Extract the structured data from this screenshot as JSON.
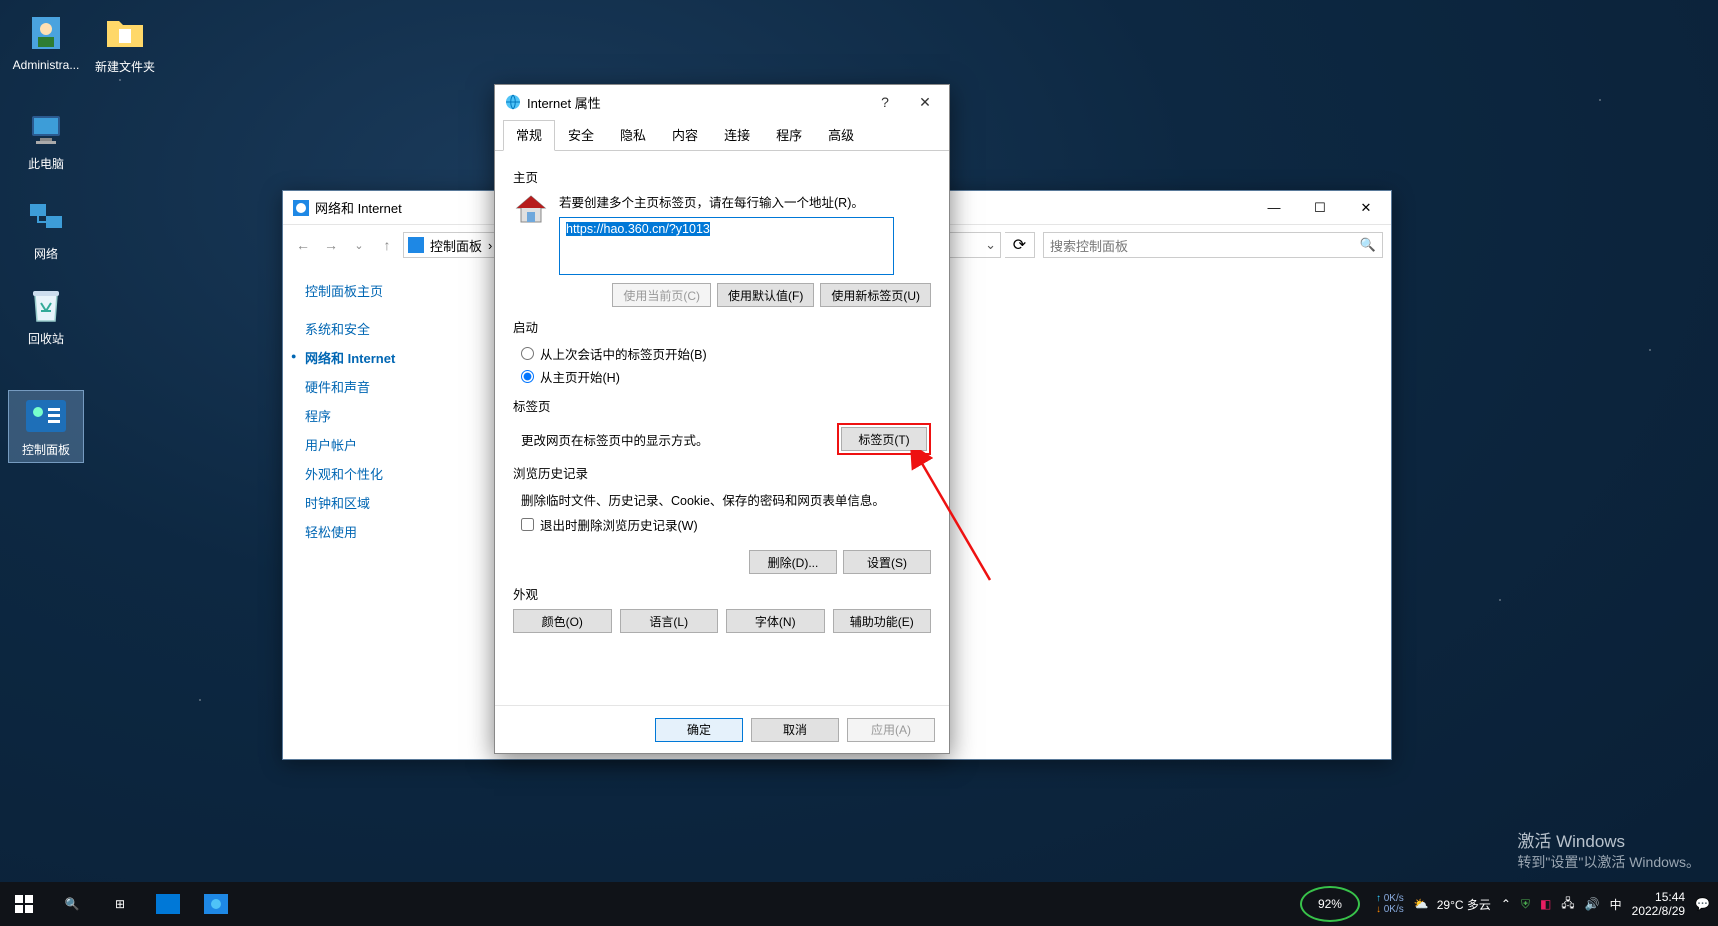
{
  "desktop": {
    "icons": {
      "admin": "Administra...",
      "folder": "新建文件夹",
      "pc": "此电脑",
      "network": "网络",
      "recycle": "回收站",
      "cpanel": "控制面板"
    }
  },
  "cp": {
    "title": "网络和 Internet",
    "breadcrumb": "控制面板",
    "breadcrumb_sep": "›",
    "search_placeholder": "搜索控制面板",
    "sidebar": {
      "heading": "控制面板主页",
      "items": [
        "系统和安全",
        "网络和 Internet",
        "硬件和声音",
        "程序",
        "用户帐户",
        "外观和个性化",
        "时钟和区域",
        "轻松使用"
      ]
    }
  },
  "dlg": {
    "title": "Internet 属性",
    "tabs": [
      "常规",
      "安全",
      "隐私",
      "内容",
      "连接",
      "程序",
      "高级"
    ],
    "sections": {
      "homepage": "主页",
      "homepage_hint": "若要创建多个主页标签页，请在每行输入一个地址(R)。",
      "url": "https://hao.360.cn/?y1013",
      "btn_current": "使用当前页(C)",
      "btn_default": "使用默认值(F)",
      "btn_newtab": "使用新标签页(U)",
      "startup": "启动",
      "radio_last": "从上次会话中的标签页开始(B)",
      "radio_home": "从主页开始(H)",
      "tabpages": "标签页",
      "tabpage_hint": "更改网页在标签页中的显示方式。",
      "btn_tabpage": "标签页(T)",
      "history": "浏览历史记录",
      "history_hint": "删除临时文件、历史记录、Cookie、保存的密码和网页表单信息。",
      "check_exit": "退出时删除浏览历史记录(W)",
      "btn_delete": "删除(D)...",
      "btn_settings": "设置(S)",
      "appearance": "外观",
      "btn_color": "颜色(O)",
      "btn_lang": "语言(L)",
      "btn_font": "字体(N)",
      "btn_access": "辅助功能(E)",
      "btn_ok": "确定",
      "btn_cancel": "取消",
      "btn_apply": "应用(A)"
    }
  },
  "taskbar": {
    "weather": "29°C 多云",
    "net_pct": "92%",
    "net_up": "0K/s",
    "net_dn": "0K/s",
    "ime": "中",
    "time": "15:44",
    "date": "2022/8/29"
  },
  "watermark": {
    "l1": "激活 Windows",
    "l2": "转到\"设置\"以激活 Windows。"
  }
}
